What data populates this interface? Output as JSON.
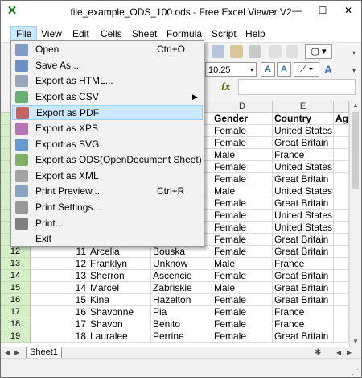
{
  "window": {
    "title": "file_example_ODS_100.ods - Free Excel Viewer V2",
    "minimize": "—",
    "maximize": "☐",
    "close": "✕"
  },
  "menubar": [
    "File",
    "View",
    "Edit",
    "Cells",
    "Sheet",
    "Formula",
    "Script",
    "Help"
  ],
  "toolbar": {
    "font_size": "10.25",
    "fx": "fx"
  },
  "file_menu": [
    {
      "label": "Open",
      "shortcut": "Ctrl+O",
      "icon": "folder-open-icon"
    },
    {
      "label": "Save As...",
      "shortcut": "",
      "icon": "save-icon"
    },
    {
      "label": "Export as HTML...",
      "shortcut": "",
      "icon": "html-icon"
    },
    {
      "label": "Export as CSV",
      "shortcut": "",
      "icon": "csv-icon",
      "submenu": true
    },
    {
      "label": "Export as PDF",
      "shortcut": "",
      "icon": "pdf-icon",
      "highlighted": true
    },
    {
      "label": "Export as XPS",
      "shortcut": "",
      "icon": "xps-icon"
    },
    {
      "label": "Export as SVG",
      "shortcut": "",
      "icon": "svg-icon"
    },
    {
      "label": "Export as ODS(OpenDocument Sheet)",
      "shortcut": "",
      "icon": "ods-icon"
    },
    {
      "label": "Export as XML",
      "shortcut": "",
      "icon": "xml-icon"
    },
    {
      "label": "Print Preview...",
      "shortcut": "Ctrl+R",
      "icon": "print-preview-icon"
    },
    {
      "label": "Print Settings...",
      "shortcut": "",
      "icon": "print-settings-icon"
    },
    {
      "label": "Print...",
      "shortcut": "",
      "icon": "printer-icon"
    },
    {
      "label": "Exit",
      "shortcut": "",
      "icon": ""
    }
  ],
  "columns": [
    {
      "letter": "D"
    },
    {
      "letter": "E"
    },
    {
      "letter": ""
    }
  ],
  "rows": [
    {
      "num": "",
      "id": "",
      "first": "",
      "last": "",
      "gender": "Gender",
      "country": "Country",
      "age": "Ag",
      "header": true
    },
    {
      "num": "",
      "id": "",
      "first": "",
      "last": "",
      "gender": "Female",
      "country": "United States",
      "age": ""
    },
    {
      "num": "",
      "id": "",
      "first": "",
      "last": "",
      "gender": "Female",
      "country": "Great Britain",
      "age": ""
    },
    {
      "num": "",
      "id": "",
      "first": "",
      "last": "",
      "gender": "Male",
      "country": "France",
      "age": ""
    },
    {
      "num": "",
      "id": "",
      "first": "",
      "last": "",
      "gender": "Female",
      "country": "United States",
      "age": ""
    },
    {
      "num": "",
      "id": "",
      "first": "",
      "last": "",
      "gender": "Female",
      "country": "Great Britain",
      "age": ""
    },
    {
      "num": "",
      "id": "",
      "first": "",
      "last": "",
      "gender": "Male",
      "country": "United States",
      "age": ""
    },
    {
      "num": "",
      "id": "",
      "first": "",
      "last": "",
      "gender": "Female",
      "country": "Great Britain",
      "age": ""
    },
    {
      "num": "",
      "id": "",
      "first": "",
      "last": "",
      "gender": "Female",
      "country": "United States",
      "age": ""
    },
    {
      "num": "",
      "id": "",
      "first": "",
      "last": "",
      "gender": "Female",
      "country": "United States",
      "age": ""
    },
    {
      "num": "",
      "id": "",
      "first": "",
      "last": "",
      "gender": "Female",
      "country": "Great Britain",
      "age": ""
    },
    {
      "num": "12",
      "id": "11",
      "first": "Arcelia",
      "last": "Bouska",
      "gender": "Female",
      "country": "Great Britain",
      "age": ""
    },
    {
      "num": "13",
      "id": "12",
      "first": "Franklyn",
      "last": "Unknow",
      "gender": "Male",
      "country": "France",
      "age": ""
    },
    {
      "num": "14",
      "id": "13",
      "first": "Sherron",
      "last": "Ascencio",
      "gender": "Female",
      "country": "Great Britain",
      "age": ""
    },
    {
      "num": "15",
      "id": "14",
      "first": "Marcel",
      "last": "Zabriskie",
      "gender": "Male",
      "country": "Great Britain",
      "age": ""
    },
    {
      "num": "16",
      "id": "15",
      "first": "Kina",
      "last": "Hazelton",
      "gender": "Female",
      "country": "Great Britain",
      "age": ""
    },
    {
      "num": "17",
      "id": "16",
      "first": "Shavonne",
      "last": "Pia",
      "gender": "Female",
      "country": "France",
      "age": ""
    },
    {
      "num": "18",
      "id": "17",
      "first": "Shavon",
      "last": "Benito",
      "gender": "Female",
      "country": "France",
      "age": ""
    },
    {
      "num": "19",
      "id": "18",
      "first": "Lauralee",
      "last": "Perrine",
      "gender": "Female",
      "country": "Great Britain",
      "age": ""
    }
  ],
  "sheet_tabs": [
    "Sheet1"
  ],
  "colors": {
    "row_header_bg": "#d7efc9",
    "menu_highlight": "#cce8ff",
    "menu_highlight_border": "#99d1ff"
  }
}
